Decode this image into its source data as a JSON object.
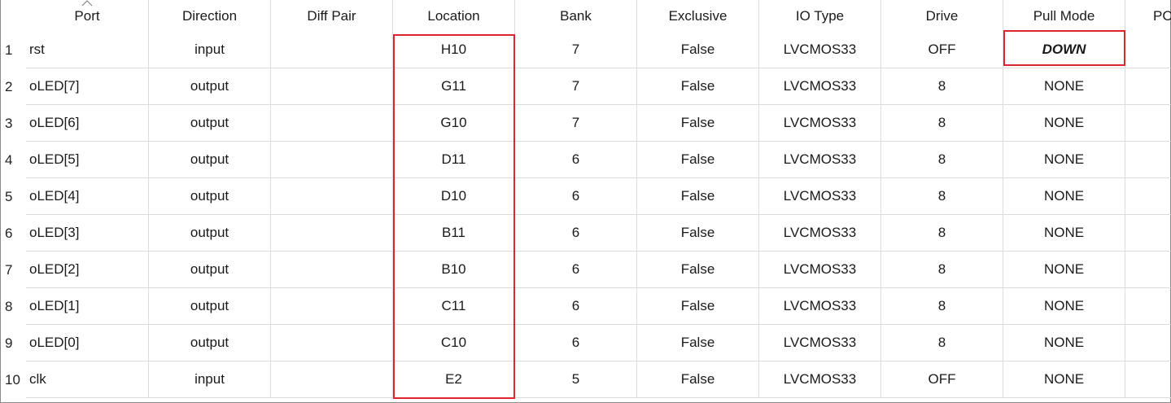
{
  "columns": [
    "Port",
    "Direction",
    "Diff Pair",
    "Location",
    "Bank",
    "Exclusive",
    "IO Type",
    "Drive",
    "Pull Mode",
    "PC"
  ],
  "sort": {
    "column": "Port",
    "icon": "sort-caret-up-icon"
  },
  "rows": [
    {
      "num": "1",
      "port": "rst",
      "direction": "input",
      "diff_pair": "",
      "location": "H10",
      "bank": "7",
      "exclusive": "False",
      "io_type": "LVCMOS33",
      "drive": "OFF",
      "pull_mode": "DOWN"
    },
    {
      "num": "2",
      "port": "oLED[7]",
      "direction": "output",
      "diff_pair": "",
      "location": "G11",
      "bank": "7",
      "exclusive": "False",
      "io_type": "LVCMOS33",
      "drive": "8",
      "pull_mode": "NONE"
    },
    {
      "num": "3",
      "port": "oLED[6]",
      "direction": "output",
      "diff_pair": "",
      "location": "G10",
      "bank": "7",
      "exclusive": "False",
      "io_type": "LVCMOS33",
      "drive": "8",
      "pull_mode": "NONE"
    },
    {
      "num": "4",
      "port": "oLED[5]",
      "direction": "output",
      "diff_pair": "",
      "location": "D11",
      "bank": "6",
      "exclusive": "False",
      "io_type": "LVCMOS33",
      "drive": "8",
      "pull_mode": "NONE"
    },
    {
      "num": "5",
      "port": "oLED[4]",
      "direction": "output",
      "diff_pair": "",
      "location": "D10",
      "bank": "6",
      "exclusive": "False",
      "io_type": "LVCMOS33",
      "drive": "8",
      "pull_mode": "NONE"
    },
    {
      "num": "6",
      "port": "oLED[3]",
      "direction": "output",
      "diff_pair": "",
      "location": "B11",
      "bank": "6",
      "exclusive": "False",
      "io_type": "LVCMOS33",
      "drive": "8",
      "pull_mode": "NONE"
    },
    {
      "num": "7",
      "port": "oLED[2]",
      "direction": "output",
      "diff_pair": "",
      "location": "B10",
      "bank": "6",
      "exclusive": "False",
      "io_type": "LVCMOS33",
      "drive": "8",
      "pull_mode": "NONE"
    },
    {
      "num": "8",
      "port": "oLED[1]",
      "direction": "output",
      "diff_pair": "",
      "location": "C11",
      "bank": "6",
      "exclusive": "False",
      "io_type": "LVCMOS33",
      "drive": "8",
      "pull_mode": "NONE"
    },
    {
      "num": "9",
      "port": "oLED[0]",
      "direction": "output",
      "diff_pair": "",
      "location": "C10",
      "bank": "6",
      "exclusive": "False",
      "io_type": "LVCMOS33",
      "drive": "8",
      "pull_mode": "NONE"
    },
    {
      "num": "10",
      "port": "clk",
      "direction": "input",
      "diff_pair": "",
      "location": "E2",
      "bank": "5",
      "exclusive": "False",
      "io_type": "LVCMOS33",
      "drive": "OFF",
      "pull_mode": "NONE"
    }
  ],
  "highlights": {
    "color": "#e0242b",
    "location_column": "Location",
    "pull_mode_cell": "DOWN"
  },
  "colors": {
    "grid_line": "#dcdcdc",
    "frame": "#8a8a8a",
    "text": "#1a1a1a"
  }
}
